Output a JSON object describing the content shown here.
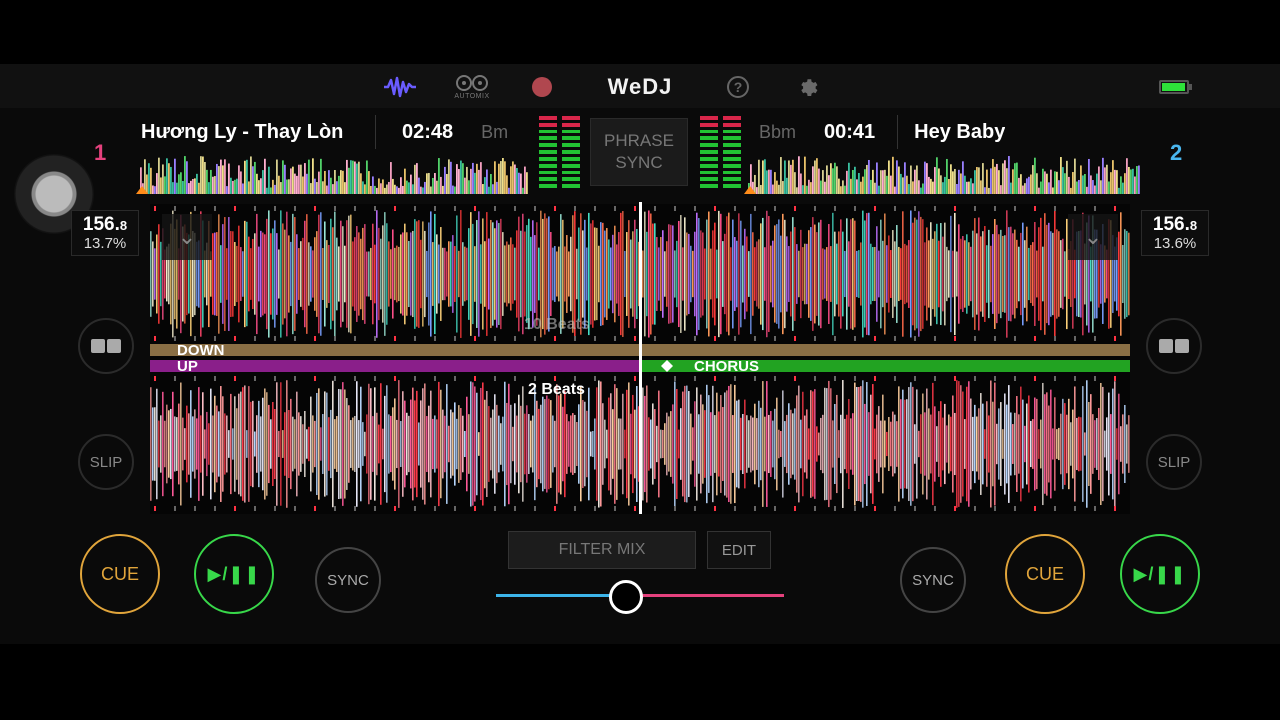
{
  "toolbar": {
    "automix_label": "AUTOMIX",
    "logo": "WeDJ",
    "help_symbol": "?",
    "icons": [
      "waveform-icon",
      "automix-icon",
      "record-icon",
      "help-icon",
      "gear-icon",
      "battery-icon"
    ],
    "battery_level": 0.9
  },
  "deck1": {
    "number": "1",
    "title": "Hương Ly - Thay Lòn",
    "time": "02:48",
    "key": "Bm",
    "bpm_int": "156.",
    "bpm_dec": "8",
    "pitch": "13.7%",
    "cue_label": "CUE",
    "play_label": "▶/❚❚",
    "sync_label": "SYNC",
    "slip_label": "SLIP",
    "color": "#e5417d"
  },
  "deck2": {
    "number": "2",
    "title": "Hey Baby",
    "time": "00:41",
    "key": "Bbm",
    "bpm_int": "156.",
    "bpm_dec": "8",
    "pitch": "13.6%",
    "cue_label": "CUE",
    "play_label": "▶/❚❚",
    "sync_label": "SYNC",
    "slip_label": "SLIP",
    "color": "#4ab6ee"
  },
  "center": {
    "phrase_line1": "PHRASE",
    "phrase_line2": "SYNC",
    "filter_label": "FILTER MIX",
    "edit_label": "EDIT",
    "crossfader_position": 0.45
  },
  "waveform": {
    "top_beats": "10 Beats",
    "bottom_beats": "2 Beats",
    "phrase_down": "DOWN",
    "phrase_up": "UP",
    "phrase_chorus": "CHORUS"
  },
  "colors": {
    "cue": "#e1a53b",
    "play": "#38d84a",
    "phrase_down": "#8a6f45",
    "phrase_up": "#8a1f8a",
    "phrase_chorus": "#22a322"
  }
}
